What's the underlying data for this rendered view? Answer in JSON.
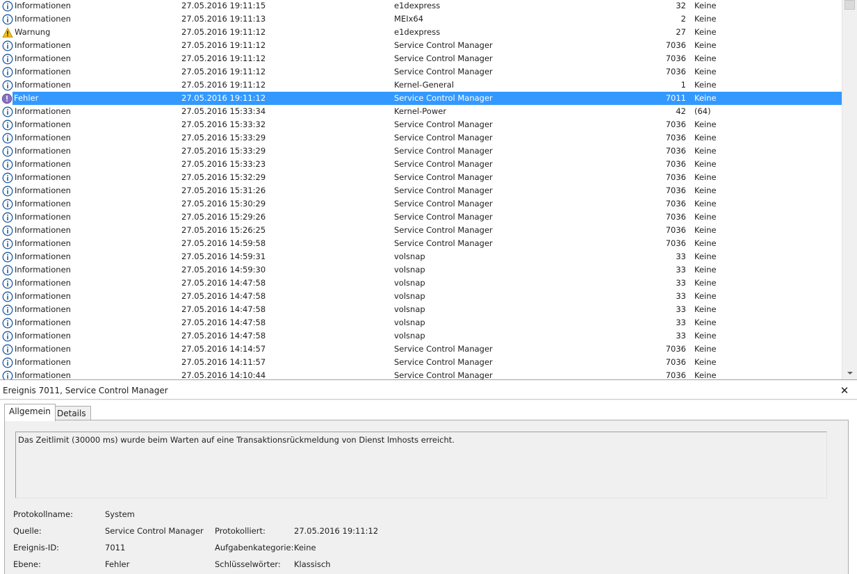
{
  "events": [
    {
      "level": "Informationen",
      "icon": "info",
      "date": "27.05.2016 19:11:15",
      "source": "e1dexpress",
      "id": "32",
      "task": "Keine"
    },
    {
      "level": "Informationen",
      "icon": "info",
      "date": "27.05.2016 19:11:13",
      "source": "MEIx64",
      "id": "2",
      "task": "Keine"
    },
    {
      "level": "Warnung",
      "icon": "warning",
      "date": "27.05.2016 19:11:12",
      "source": "e1dexpress",
      "id": "27",
      "task": "Keine"
    },
    {
      "level": "Informationen",
      "icon": "info",
      "date": "27.05.2016 19:11:12",
      "source": "Service Control Manager",
      "id": "7036",
      "task": "Keine"
    },
    {
      "level": "Informationen",
      "icon": "info",
      "date": "27.05.2016 19:11:12",
      "source": "Service Control Manager",
      "id": "7036",
      "task": "Keine"
    },
    {
      "level": "Informationen",
      "icon": "info",
      "date": "27.05.2016 19:11:12",
      "source": "Service Control Manager",
      "id": "7036",
      "task": "Keine"
    },
    {
      "level": "Informationen",
      "icon": "info",
      "date": "27.05.2016 19:11:12",
      "source": "Kernel-General",
      "id": "1",
      "task": "Keine"
    },
    {
      "level": "Fehler",
      "icon": "error",
      "date": "27.05.2016 19:11:12",
      "source": "Service Control Manager",
      "id": "7011",
      "task": "Keine",
      "selected": true
    },
    {
      "level": "Informationen",
      "icon": "info",
      "date": "27.05.2016 15:33:34",
      "source": "Kernel-Power",
      "id": "42",
      "task": "(64)"
    },
    {
      "level": "Informationen",
      "icon": "info",
      "date": "27.05.2016 15:33:32",
      "source": "Service Control Manager",
      "id": "7036",
      "task": "Keine"
    },
    {
      "level": "Informationen",
      "icon": "info",
      "date": "27.05.2016 15:33:29",
      "source": "Service Control Manager",
      "id": "7036",
      "task": "Keine"
    },
    {
      "level": "Informationen",
      "icon": "info",
      "date": "27.05.2016 15:33:29",
      "source": "Service Control Manager",
      "id": "7036",
      "task": "Keine"
    },
    {
      "level": "Informationen",
      "icon": "info",
      "date": "27.05.2016 15:33:23",
      "source": "Service Control Manager",
      "id": "7036",
      "task": "Keine"
    },
    {
      "level": "Informationen",
      "icon": "info",
      "date": "27.05.2016 15:32:29",
      "source": "Service Control Manager",
      "id": "7036",
      "task": "Keine"
    },
    {
      "level": "Informationen",
      "icon": "info",
      "date": "27.05.2016 15:31:26",
      "source": "Service Control Manager",
      "id": "7036",
      "task": "Keine"
    },
    {
      "level": "Informationen",
      "icon": "info",
      "date": "27.05.2016 15:30:29",
      "source": "Service Control Manager",
      "id": "7036",
      "task": "Keine"
    },
    {
      "level": "Informationen",
      "icon": "info",
      "date": "27.05.2016 15:29:26",
      "source": "Service Control Manager",
      "id": "7036",
      "task": "Keine"
    },
    {
      "level": "Informationen",
      "icon": "info",
      "date": "27.05.2016 15:26:25",
      "source": "Service Control Manager",
      "id": "7036",
      "task": "Keine"
    },
    {
      "level": "Informationen",
      "icon": "info",
      "date": "27.05.2016 14:59:58",
      "source": "Service Control Manager",
      "id": "7036",
      "task": "Keine"
    },
    {
      "level": "Informationen",
      "icon": "info",
      "date": "27.05.2016 14:59:31",
      "source": "volsnap",
      "id": "33",
      "task": "Keine"
    },
    {
      "level": "Informationen",
      "icon": "info",
      "date": "27.05.2016 14:59:30",
      "source": "volsnap",
      "id": "33",
      "task": "Keine"
    },
    {
      "level": "Informationen",
      "icon": "info",
      "date": "27.05.2016 14:47:58",
      "source": "volsnap",
      "id": "33",
      "task": "Keine"
    },
    {
      "level": "Informationen",
      "icon": "info",
      "date": "27.05.2016 14:47:58",
      "source": "volsnap",
      "id": "33",
      "task": "Keine"
    },
    {
      "level": "Informationen",
      "icon": "info",
      "date": "27.05.2016 14:47:58",
      "source": "volsnap",
      "id": "33",
      "task": "Keine"
    },
    {
      "level": "Informationen",
      "icon": "info",
      "date": "27.05.2016 14:47:58",
      "source": "volsnap",
      "id": "33",
      "task": "Keine"
    },
    {
      "level": "Informationen",
      "icon": "info",
      "date": "27.05.2016 14:47:58",
      "source": "volsnap",
      "id": "33",
      "task": "Keine"
    },
    {
      "level": "Informationen",
      "icon": "info",
      "date": "27.05.2016 14:14:57",
      "source": "Service Control Manager",
      "id": "7036",
      "task": "Keine"
    },
    {
      "level": "Informationen",
      "icon": "info",
      "date": "27.05.2016 14:11:57",
      "source": "Service Control Manager",
      "id": "7036",
      "task": "Keine"
    },
    {
      "level": "Informationen",
      "icon": "info",
      "date": "27.05.2016 14:10:44",
      "source": "Service Control Manager",
      "id": "7036",
      "task": "Keine"
    }
  ],
  "detail": {
    "title": "Ereignis 7011, Service Control Manager",
    "close_icon": "close-icon",
    "tabs": {
      "general": "Allgemein",
      "details": "Details"
    },
    "message": "Das Zeitlimit (30000 ms) wurde beim Warten auf eine Transaktionsrückmeldung von Dienst lmhosts erreicht.",
    "labels": {
      "log_name": "Protokollname:",
      "source": "Quelle:",
      "event_id": "Ereignis-ID:",
      "level": "Ebene:",
      "logged": "Protokolliert:",
      "task_category": "Aufgabenkategorie:",
      "keywords": "Schlüsselwörter:"
    },
    "values": {
      "log_name": "System",
      "source": "Service Control Manager",
      "event_id": "7011",
      "level": "Fehler",
      "logged": "27.05.2016 19:11:12",
      "task_category": "Keine",
      "keywords": "Klassisch"
    }
  },
  "colors": {
    "selection": "#3399ff",
    "info_icon": "#1c5a9e",
    "warning_icon": "#f2c11c",
    "error_icon": "#8a6fc0"
  }
}
